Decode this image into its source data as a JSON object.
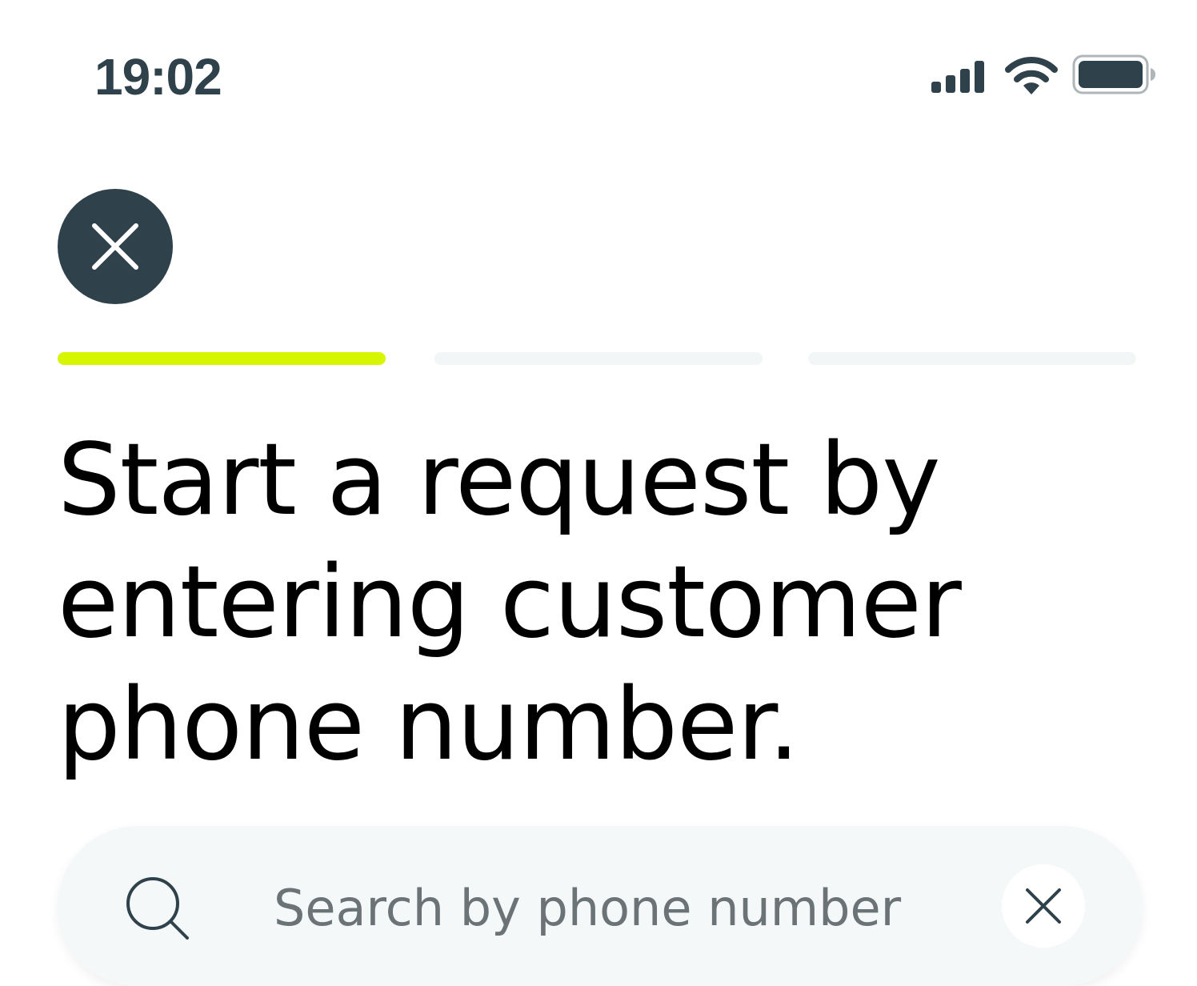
{
  "status_bar": {
    "time": "19:02",
    "icons": [
      "cellular-signal-icon",
      "wifi-icon",
      "battery-icon"
    ]
  },
  "header": {
    "close_icon": "close-icon"
  },
  "progress": {
    "total_steps": 3,
    "current_step": 1,
    "active_color": "#d6f500",
    "inactive_color": "#f3f6f7"
  },
  "main": {
    "heading": "Start a request by entering customer phone number."
  },
  "search": {
    "placeholder": "Search by phone number",
    "value": "",
    "search_icon": "search-icon",
    "clear_icon": "close-icon"
  },
  "colors": {
    "primary_dark": "#2f414b",
    "accent": "#d6f500",
    "field_background": "#f5f8f9"
  }
}
